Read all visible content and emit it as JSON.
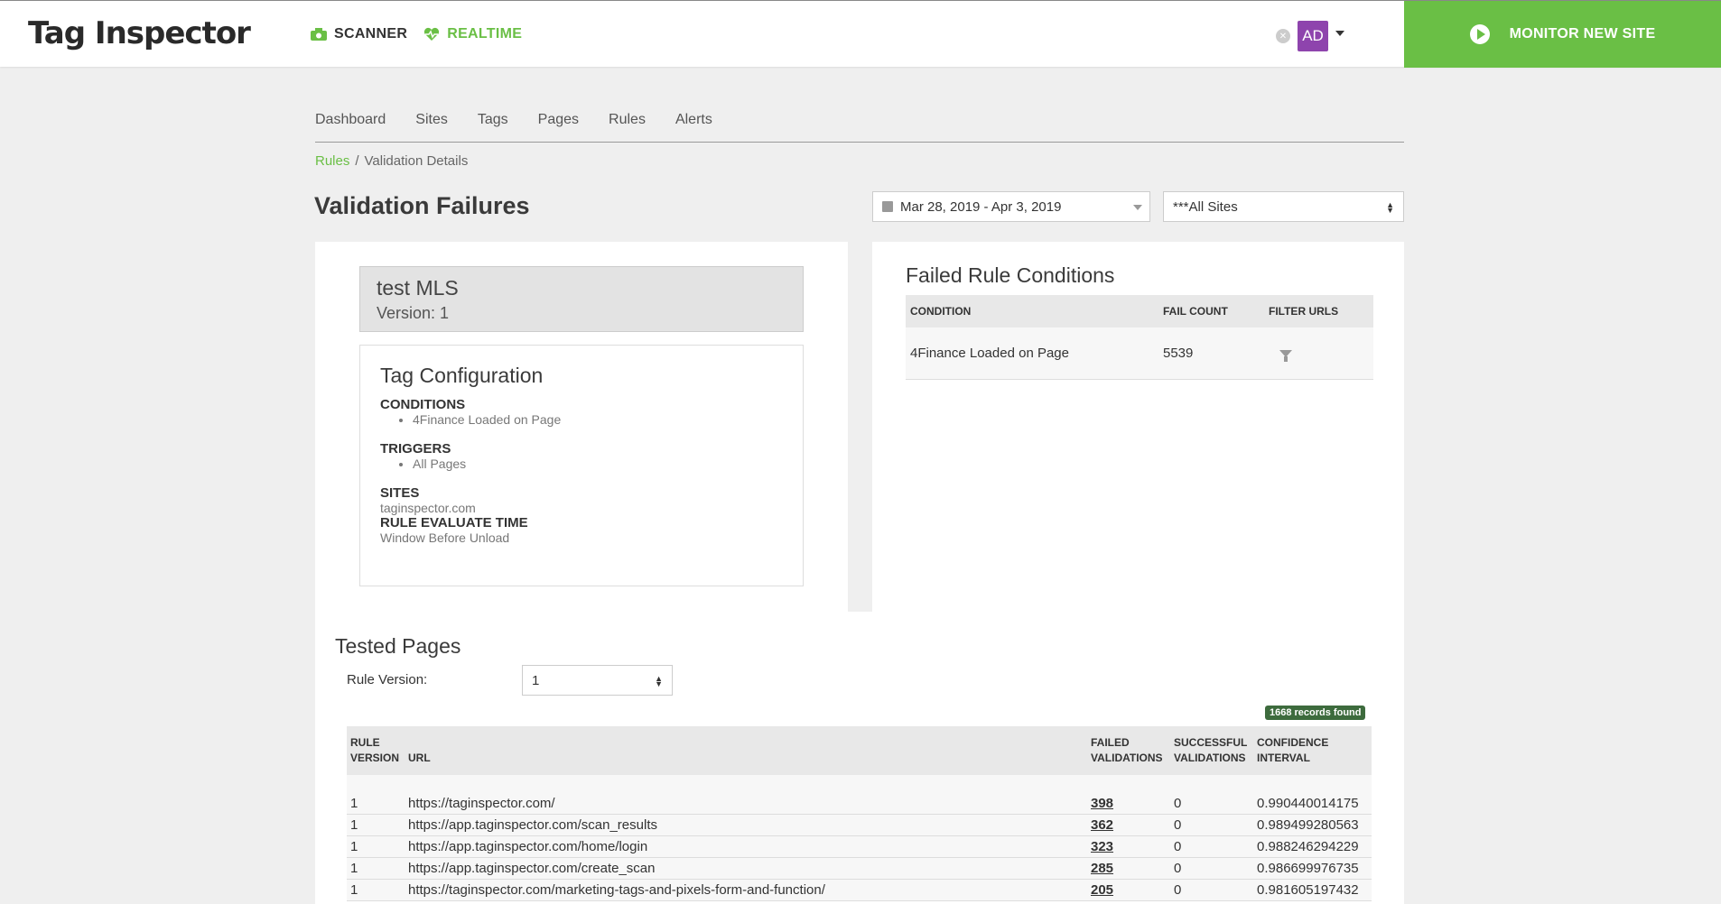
{
  "header": {
    "logo_text": "Tag Inspector",
    "nav": [
      {
        "label": "SCANNER",
        "icon": "camera-icon"
      },
      {
        "label": "REALTIME",
        "icon": "heartbeat-icon"
      }
    ],
    "user_initials": "AD",
    "monitor_button": "MONITOR NEW SITE",
    "colors": {
      "accent": "#6abf45",
      "avatar": "#8e44ad"
    }
  },
  "subnav": [
    "Dashboard",
    "Sites",
    "Tags",
    "Pages",
    "Rules",
    "Alerts"
  ],
  "breadcrumb": {
    "link": "Rules",
    "separator": "/",
    "current": "Validation Details"
  },
  "page_title": "Validation Failures",
  "date_range": "Mar 28, 2019 - Apr 3, 2019",
  "site_select": "***All Sites",
  "rule": {
    "name": "test MLS",
    "version": "Version: 1"
  },
  "tag_config": {
    "title": "Tag Configuration",
    "conditions_label": "CONDITIONS",
    "conditions": [
      "4Finance Loaded on Page"
    ],
    "triggers_label": "TRIGGERS",
    "triggers": [
      "All Pages"
    ],
    "sites_label": "SITES",
    "sites": "taginspector.com",
    "eval_label": "RULE EVALUATE TIME",
    "eval_value": "Window Before Unload"
  },
  "failed_conditions": {
    "title": "Failed Rule Conditions",
    "columns": [
      "CONDITION",
      "FAIL COUNT",
      "FILTER URLS"
    ],
    "rows": [
      {
        "condition": "4Finance Loaded on Page",
        "fail_count": "5539"
      }
    ]
  },
  "tested_pages": {
    "title": "Tested Pages",
    "rule_version_label": "Rule Version:",
    "rule_version_value": "1",
    "records": "1668 records found",
    "columns": {
      "rule_version": [
        "RULE",
        "VERSION"
      ],
      "url": "URL",
      "failed": [
        "FAILED",
        "VALIDATIONS"
      ],
      "successful": [
        "SUCCESSFUL",
        "VALIDATIONS"
      ],
      "confidence": [
        "CONFIDENCE",
        "INTERVAL"
      ]
    },
    "rows": [
      {
        "version": "1",
        "url": "https://taginspector.com/",
        "failed": "398",
        "successful": "0",
        "confidence": "0.990440014175"
      },
      {
        "version": "1",
        "url": "https://app.taginspector.com/scan_results",
        "failed": "362",
        "successful": "0",
        "confidence": "0.989499280563"
      },
      {
        "version": "1",
        "url": "https://app.taginspector.com/home/login",
        "failed": "323",
        "successful": "0",
        "confidence": "0.988246294229"
      },
      {
        "version": "1",
        "url": "https://app.taginspector.com/create_scan",
        "failed": "285",
        "successful": "0",
        "confidence": "0.986699976735"
      },
      {
        "version": "1",
        "url": "https://taginspector.com/marketing-tags-and-pixels-form-and-function/",
        "failed": "205",
        "successful": "0",
        "confidence": "0.981605197432"
      }
    ]
  }
}
